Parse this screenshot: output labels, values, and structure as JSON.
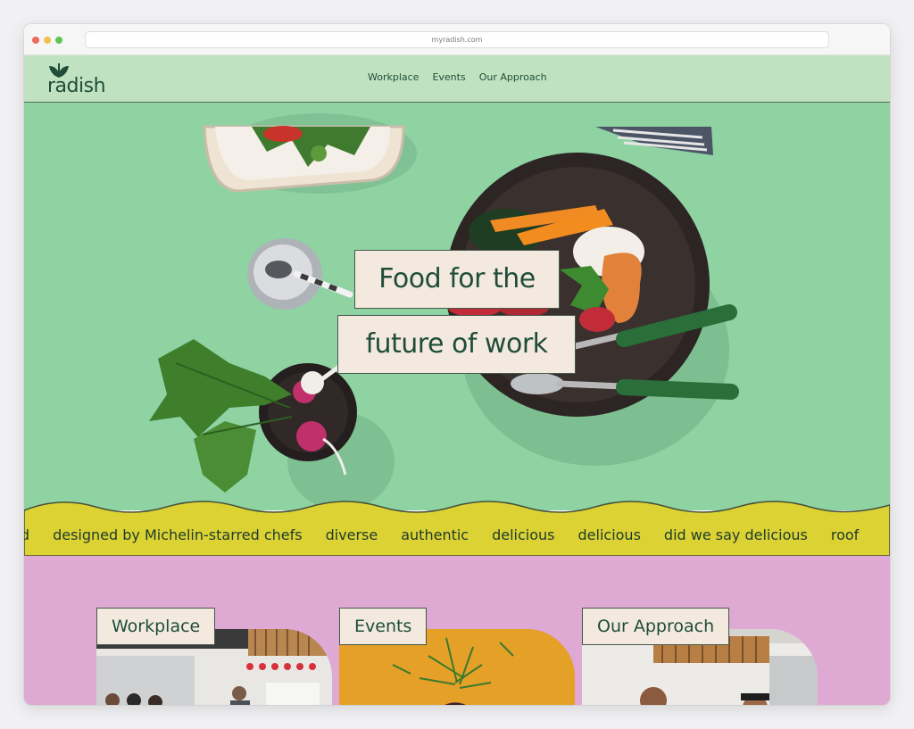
{
  "browser": {
    "url": "myradish.com"
  },
  "brand": {
    "logo_text": "radish"
  },
  "nav": {
    "links": [
      {
        "label": "Workplace"
      },
      {
        "label": "Events"
      },
      {
        "label": "Our Approach"
      }
    ]
  },
  "hero": {
    "headline_line1": "Food for the",
    "headline_line2": "future of work"
  },
  "ticker": {
    "items": [
      "ered",
      "designed by Michelin-starred chefs",
      "diverse",
      "authentic",
      "delicious",
      "delicious",
      "did we say delicious",
      "roof"
    ]
  },
  "cards": [
    {
      "label": "Workplace"
    },
    {
      "label": "Events"
    },
    {
      "label": "Our Approach"
    }
  ],
  "colors": {
    "hero_green": "#8fd3a3",
    "ticker_yellow": "#dcd233",
    "section_pink": "#dea9d3",
    "label_cream": "#f3e9df",
    "text_dark_green": "#1f4d3a"
  },
  "icons": [
    "leaf-logo-icon"
  ]
}
